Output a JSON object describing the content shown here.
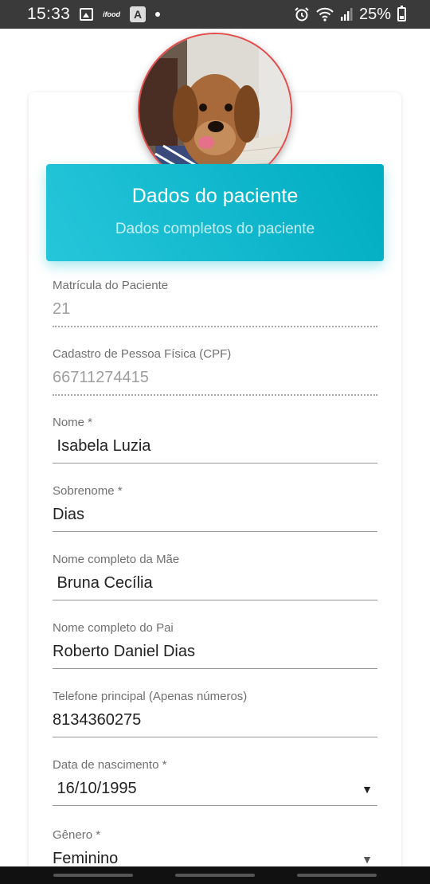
{
  "status_bar": {
    "time": "15:33",
    "app_text": "ifood",
    "battery": "25%"
  },
  "header": {
    "title": "Dados do paciente",
    "subtitle": "Dados completos do paciente"
  },
  "fields": [
    {
      "label": "Matrícula do Paciente",
      "value": "21"
    },
    {
      "label": "Cadastro de Pessoa Física (CPF)",
      "value": "66711274415"
    },
    {
      "label": "Nome *",
      "value": " Isabela Luzia"
    },
    {
      "label": "Sobrenome *",
      "value": "Dias"
    },
    {
      "label": "Nome completo da Mãe",
      "value": " Bruna Cecília"
    },
    {
      "label": "Nome completo do Pai",
      "value": "Roberto Daniel Dias"
    },
    {
      "label": "Telefone principal (Apenas números)",
      "value": "8134360275"
    },
    {
      "label": "Data de nascimento *",
      "value": " 16/10/1995"
    },
    {
      "label": "Gênero *",
      "value": "Feminino"
    }
  ]
}
